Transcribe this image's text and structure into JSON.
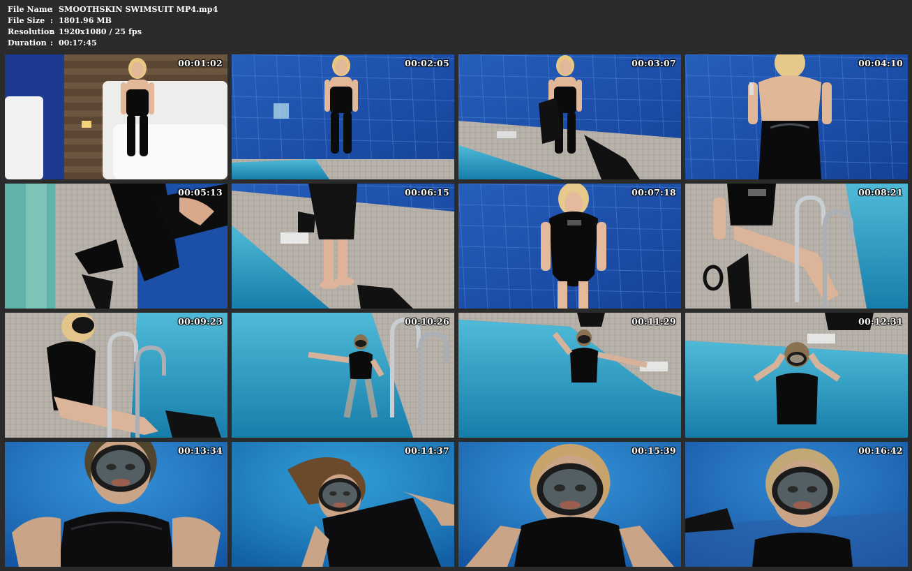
{
  "file_info": {
    "rows": [
      {
        "key": "File Name",
        "sep": ":",
        "value": "SMOOTHSKIN SWIMSUIT MP4.mp4"
      },
      {
        "key": "File Size",
        "sep": ":",
        "value": "1801.96 MB"
      },
      {
        "key": "Resolution",
        "sep": ":",
        "value": "1920x1080 / 25 fps"
      },
      {
        "key": "Duration",
        "sep": ":",
        "value": "00:17:45"
      }
    ]
  },
  "thumbnails": [
    {
      "time": "00:01:02",
      "scene": "room-lounge"
    },
    {
      "time": "00:02:05",
      "scene": "pool-standing"
    },
    {
      "time": "00:03:07",
      "scene": "pool-standing-fins"
    },
    {
      "time": "00:04:10",
      "scene": "pool-back-view"
    },
    {
      "time": "00:05:13",
      "scene": "heels-closeup"
    },
    {
      "time": "00:06:15",
      "scene": "poolside-feet"
    },
    {
      "time": "00:07:18",
      "scene": "swimsuit-portrait"
    },
    {
      "time": "00:08:21",
      "scene": "poolside-ladder-sitting"
    },
    {
      "time": "00:09:23",
      "scene": "ladder-mask"
    },
    {
      "time": "00:10:26",
      "scene": "pool-entering"
    },
    {
      "time": "00:11:29",
      "scene": "pool-wading"
    },
    {
      "time": "00:12:31",
      "scene": "pool-adjusting-mask"
    },
    {
      "time": "00:13:34",
      "scene": "underwater-mask-1"
    },
    {
      "time": "00:14:37",
      "scene": "underwater-mask-2"
    },
    {
      "time": "00:15:39",
      "scene": "underwater-mask-3"
    },
    {
      "time": "00:16:42",
      "scene": "underwater-mask-4"
    }
  ],
  "colors": {
    "background": "#2b2b2b",
    "pool_wall": "#1c4fa8",
    "water": "#2a9cc9",
    "tile_floor": "#b9b4ad"
  }
}
